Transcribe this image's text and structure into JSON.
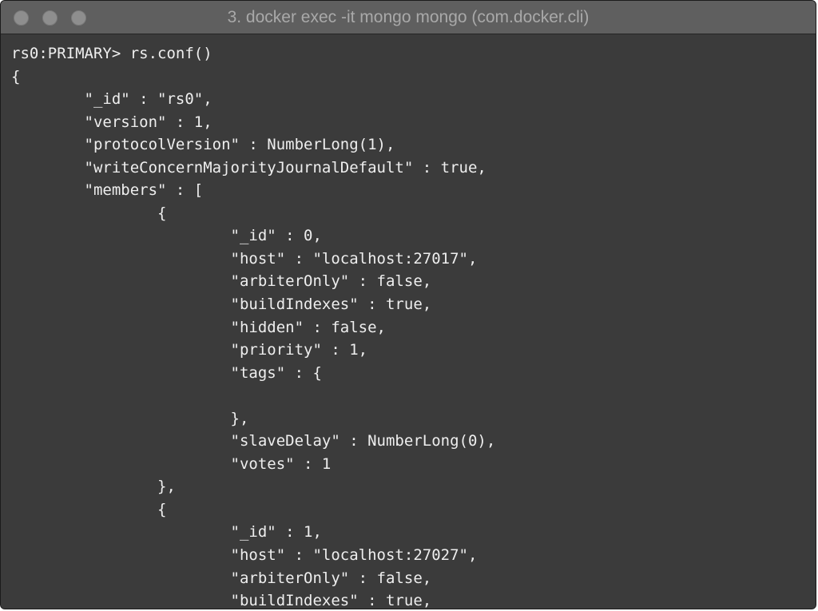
{
  "window": {
    "title": "3. docker exec -it mongo mongo (com.docker.cli)",
    "buttons": {
      "close": "close-button",
      "minimize": "minimize-button",
      "maximize": "zoom-button"
    },
    "colors": {
      "titlebar": "#5f5f5f",
      "background": "#3b3b3b",
      "text": "#eeeeee"
    }
  },
  "terminal": {
    "lines": [
      "rs0:PRIMARY> rs.conf()",
      "{",
      "        \"_id\" : \"rs0\",",
      "        \"version\" : 1,",
      "        \"protocolVersion\" : NumberLong(1),",
      "        \"writeConcernMajorityJournalDefault\" : true,",
      "        \"members\" : [",
      "                {",
      "                        \"_id\" : 0,",
      "                        \"host\" : \"localhost:27017\",",
      "                        \"arbiterOnly\" : false,",
      "                        \"buildIndexes\" : true,",
      "                        \"hidden\" : false,",
      "                        \"priority\" : 1,",
      "                        \"tags\" : {",
      "",
      "                        },",
      "                        \"slaveDelay\" : NumberLong(0),",
      "                        \"votes\" : 1",
      "                },",
      "                {",
      "                        \"_id\" : 1,",
      "                        \"host\" : \"localhost:27027\",",
      "                        \"arbiterOnly\" : false,",
      "                        \"buildIndexes\" : true,"
    ]
  }
}
